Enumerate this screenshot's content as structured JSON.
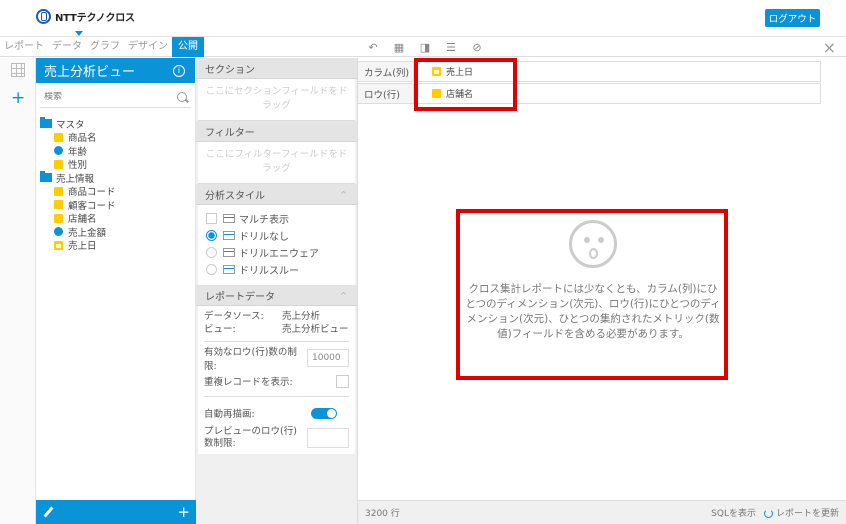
{
  "header": {
    "logo_text": "NTTテクノクロス",
    "logout_label": "ログアウト"
  },
  "tabs": [
    {
      "label": "レポート"
    },
    {
      "label": "データ"
    },
    {
      "label": "グラフ"
    },
    {
      "label": "デザイン"
    },
    {
      "label": "公開"
    }
  ],
  "view": {
    "title": "売上分析ビュー",
    "search_placeholder": "検索",
    "tree": {
      "master": {
        "label": "マスタ",
        "items": [
          "商品名",
          "年齢",
          "性別"
        ]
      },
      "sales": {
        "label": "売上情報",
        "items": [
          "商品コード",
          "顧客コード",
          "店舗名",
          "売上金額",
          "売上日"
        ]
      }
    }
  },
  "settings": {
    "section_label": "セクション",
    "section_drop": "ここにセクションフィールドをドラッグ",
    "filter_label": "フィルター",
    "filter_drop": "ここにフィルターフィールドをドラッグ",
    "style_label": "分析スタイル",
    "style_options": [
      "マルチ表示",
      "ドリルなし",
      "ドリルエニウェア",
      "ドリルスルー"
    ],
    "report_data_label": "レポートデータ",
    "datasource_key": "データソース:",
    "datasource_value": "売上分析",
    "view_key": "ビュー:",
    "view_value": "売上分析ビュー",
    "row_limit_label": "有効なロウ(行)数の制限:",
    "row_limit_value": "10000",
    "dup_label": "重複レコードを表示:",
    "auto_redraw_label": "自動再描画:",
    "preview_rows_label": "プレビューのロウ(行)数制限:"
  },
  "content": {
    "columns_label": "カラム(列)",
    "columns_field": "売上日",
    "rows_label": "ロウ(行)",
    "rows_field": "店舗名",
    "empty_message": "クロス集計レポートには少なくとも、カラム(列)にひとつのディメンション(次元)、ロウ(行)にひとつのディメンション(次元)、ひとつの集約されたメトリック(数値)フィールドを含める必要があります。",
    "row_count": "3200 行",
    "show_sql": "SQLを表示",
    "refresh_report": "レポートを更新"
  },
  "colors": {
    "accent": "#0b93d8",
    "highlight": "#e00000",
    "dimension": "#ffcc00"
  }
}
